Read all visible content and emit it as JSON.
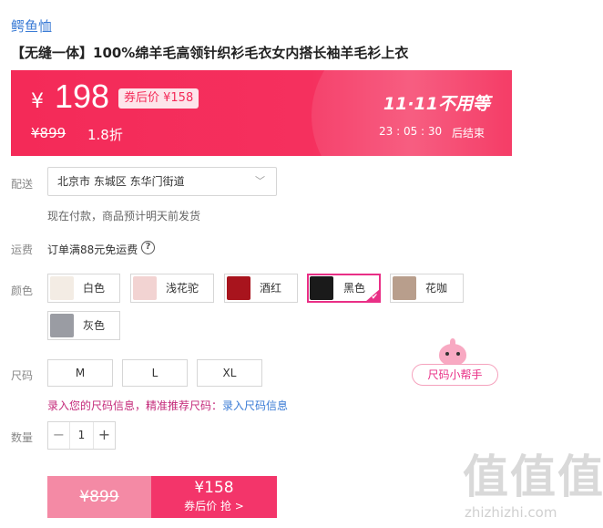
{
  "brand": "鳄鱼恤",
  "title": "【无缝一体】100%绵羊毛高领针织衫毛衣女内搭长袖羊毛衫上衣",
  "price_banner": {
    "yen": "¥",
    "price": "198",
    "coupon_tag": "券后价 ¥158",
    "original_price": "¥899",
    "discount": "1.8折",
    "promo": "11·11不用等",
    "countdown": "23 : 05 : 30",
    "countdown_suffix": "后结束",
    "accent_color": "#f42a58"
  },
  "delivery": {
    "label": "配送",
    "address": "北京市 东城区 东华门街道",
    "chevron_icon": "chevron-down-icon",
    "note": "现在付款，商品预计明天前发货"
  },
  "freight": {
    "label": "运费",
    "text": "订单满88元免运费",
    "help_icon": "?"
  },
  "colors": {
    "label": "颜色",
    "options": [
      {
        "label": "白色",
        "swatch": "#f3ece4"
      },
      {
        "label": "浅花驼",
        "swatch": "#f2d3d2"
      },
      {
        "label": "酒红",
        "swatch": "#a8141d"
      },
      {
        "label": "黑色",
        "swatch": "#1a1a1a"
      },
      {
        "label": "花咖",
        "swatch": "#b89e8c"
      },
      {
        "label": "灰色",
        "swatch": "#9a9ca3"
      }
    ],
    "selected": "黑色",
    "selected_color": "#e92f86",
    "check_glyph": "✔"
  },
  "sizes": {
    "label": "尺码",
    "options": [
      "M",
      "L",
      "XL"
    ],
    "helper": "尺码小帮手",
    "hint": "录入您的尺码信息，精准推荐尺码：",
    "hint_link": "录入尺码信息"
  },
  "quantity": {
    "label": "数量",
    "minus": "−",
    "value": "1",
    "plus": "+"
  },
  "buy": {
    "original": "¥899",
    "coupon_price": "¥158",
    "cta": "券后价 抢 >"
  },
  "watermark": {
    "mark": "值值值",
    "site": "zhizhizhi.com"
  }
}
